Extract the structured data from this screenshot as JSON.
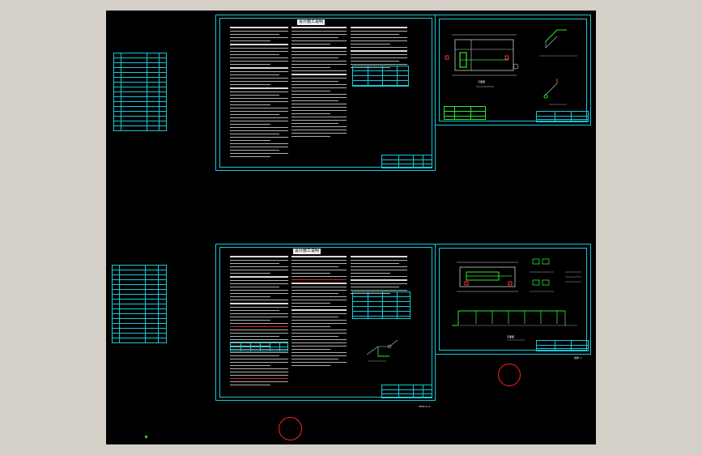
{
  "window": {
    "background_color": "#d4d0c8",
    "canvas_color": "#000000",
    "accent_cyan": "#18c8d8",
    "marker_red": "#ff2020",
    "highlight_green": "#2ee82e"
  },
  "sheets": {
    "upper_notes": {
      "title": "设计施工说明"
    },
    "lower_notes": {
      "title": "设计施工说明"
    },
    "upper_plan": {
      "caption": "平面图"
    },
    "lower_plan": {
      "caption": "平面图"
    },
    "lower_plan_sheet_no": "给排-1"
  },
  "bottom_label": "2024/1/1",
  "icons": [
    "red-circle-marker-icon",
    "ucs-origin-icon"
  ]
}
